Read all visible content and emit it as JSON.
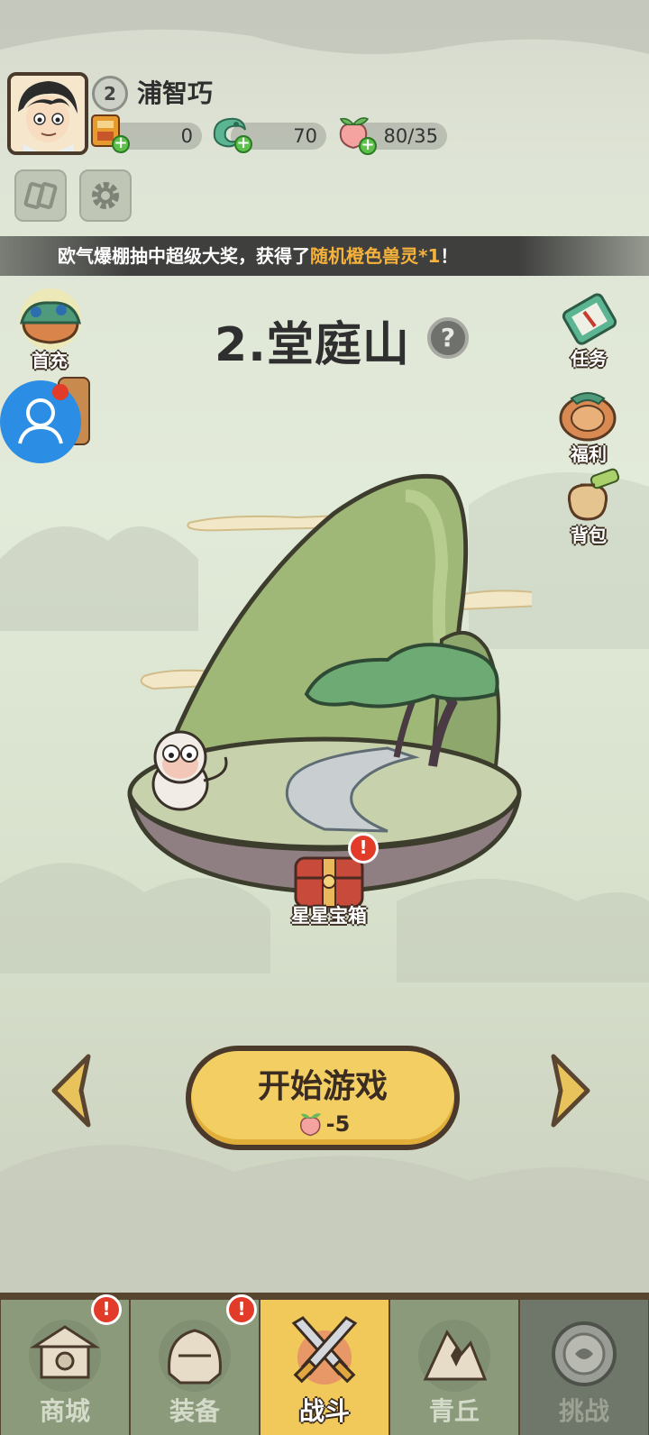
{
  "player": {
    "level": "2",
    "name": "浦智巧"
  },
  "resources": [
    {
      "id": "ticket",
      "value": "0",
      "icon": "ticket-icon"
    },
    {
      "id": "jade",
      "value": "70",
      "icon": "jade-dragon-icon"
    },
    {
      "id": "peach",
      "value": "80/35",
      "icon": "peach-icon"
    }
  ],
  "marquee": {
    "prefix": "欧气爆棚抽中超级大奖，获得了",
    "highlight": "随机橙色兽灵*1",
    "suffix": "！"
  },
  "left_side": {
    "first_recharge": "首充"
  },
  "right_side": {
    "tasks": "任务",
    "welfare": "福利",
    "backpack": "背包"
  },
  "stage": {
    "title": "2.堂庭山",
    "help_symbol": "?",
    "chest_label": "星星宝箱"
  },
  "start": {
    "label": "开始游戏",
    "cost": "-5"
  },
  "nav": [
    {
      "label": "商城",
      "alert": true,
      "state": "normal"
    },
    {
      "label": "装备",
      "alert": true,
      "state": "normal"
    },
    {
      "label": "战斗",
      "alert": false,
      "state": "active"
    },
    {
      "label": "青丘",
      "alert": false,
      "state": "normal"
    },
    {
      "label": "挑战",
      "alert": false,
      "state": "locked"
    }
  ],
  "alert_symbol": "!",
  "colors": {
    "accent_gold": "#f3cf63",
    "highlight_orange": "#f6b23a",
    "alert_red": "#e23b2a",
    "nav_brown": "#58452f"
  }
}
